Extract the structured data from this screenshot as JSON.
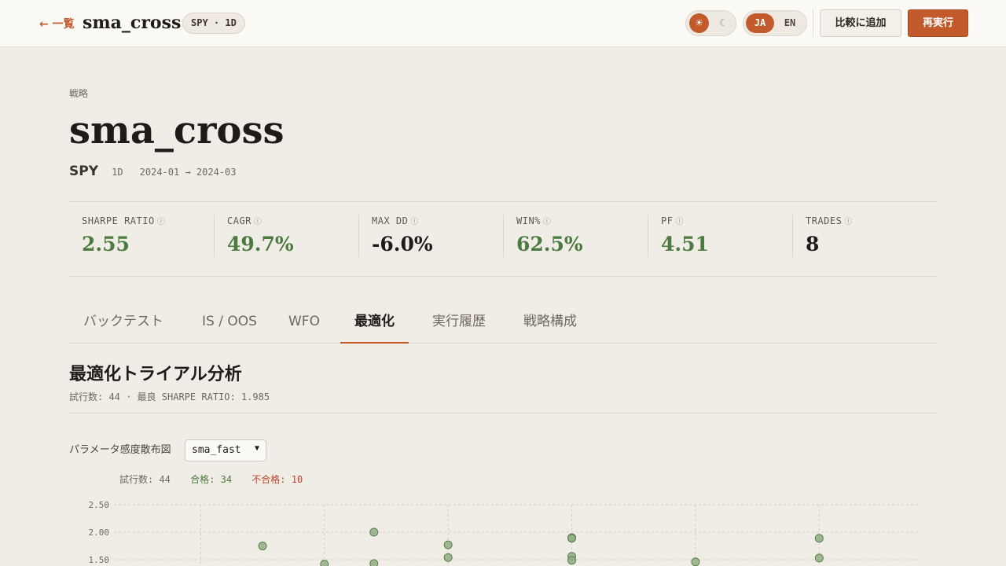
{
  "topbar": {
    "back_label": "← 一覧",
    "title": "sma_cross",
    "chip": "SPY · 1D",
    "theme_light_icon": "☀",
    "theme_dark_icon": "☾",
    "lang_ja": "JA",
    "lang_en": "EN",
    "compare_label": "比較に追加",
    "rerun_label": "再実行"
  },
  "header": {
    "eyebrow": "戦略",
    "name": "sma_cross",
    "symbol": "SPY",
    "timeframe": "1D",
    "range": "2024-01 → 2024-03"
  },
  "kpis": [
    {
      "label": "SHARPE RATIO",
      "value": "2.55",
      "color": "#4d7a40"
    },
    {
      "label": "CAGR",
      "value": "49.7%",
      "color": "#4d7a40"
    },
    {
      "label": "MAX DD",
      "value": "-6.0%",
      "color": "#1f1b16"
    },
    {
      "label": "WIN%",
      "value": "62.5%",
      "color": "#4d7a40"
    },
    {
      "label": "PF",
      "value": "4.51",
      "color": "#4d7a40"
    },
    {
      "label": "TRADES",
      "value": "8",
      "color": "#1f1b16"
    }
  ],
  "info_icon": "ⓘ",
  "tabs": [
    {
      "label": "バックテスト",
      "active": false
    },
    {
      "label": "IS / OOS",
      "active": false
    },
    {
      "label": "WFO",
      "active": false
    },
    {
      "label": "最適化",
      "active": true
    },
    {
      "label": "実行履歴",
      "active": false
    },
    {
      "label": "戦略構成",
      "active": false
    }
  ],
  "section": {
    "title": "最適化トライアル分析",
    "subtitle": "試行数: 44 · 最良 SHARPE RATIO: 1.985"
  },
  "param": {
    "label": "パラメータ感度散布図",
    "selected": "sma_fast"
  },
  "counts": {
    "total": "試行数: 44",
    "pass": "合格: 34",
    "fail": "不合格: 10"
  },
  "colors": {
    "accent": "#c25a2c",
    "positive": "#4d7a40",
    "negative": "#c0452c",
    "point_fill": "#8fae80",
    "point_stroke": "#5f7d52"
  },
  "chart_data": {
    "type": "scatter",
    "yticks": [
      2.5,
      2.0,
      1.5
    ],
    "ylim": [
      1.0,
      2.5
    ],
    "xlim": [
      0,
      13
    ],
    "grid": true,
    "points": [
      {
        "x": 3.0,
        "y": 1.75
      },
      {
        "x": 4.0,
        "y": 1.42
      },
      {
        "x": 4.8,
        "y": 2.0
      },
      {
        "x": 4.8,
        "y": 1.43
      },
      {
        "x": 6.0,
        "y": 1.77
      },
      {
        "x": 6.0,
        "y": 1.54
      },
      {
        "x": 8.0,
        "y": 1.9
      },
      {
        "x": 8.0,
        "y": 1.89
      },
      {
        "x": 8.0,
        "y": 1.56
      },
      {
        "x": 8.0,
        "y": 1.49
      },
      {
        "x": 10.0,
        "y": 1.46
      },
      {
        "x": 12.0,
        "y": 1.89
      },
      {
        "x": 12.0,
        "y": 1.53
      }
    ]
  }
}
